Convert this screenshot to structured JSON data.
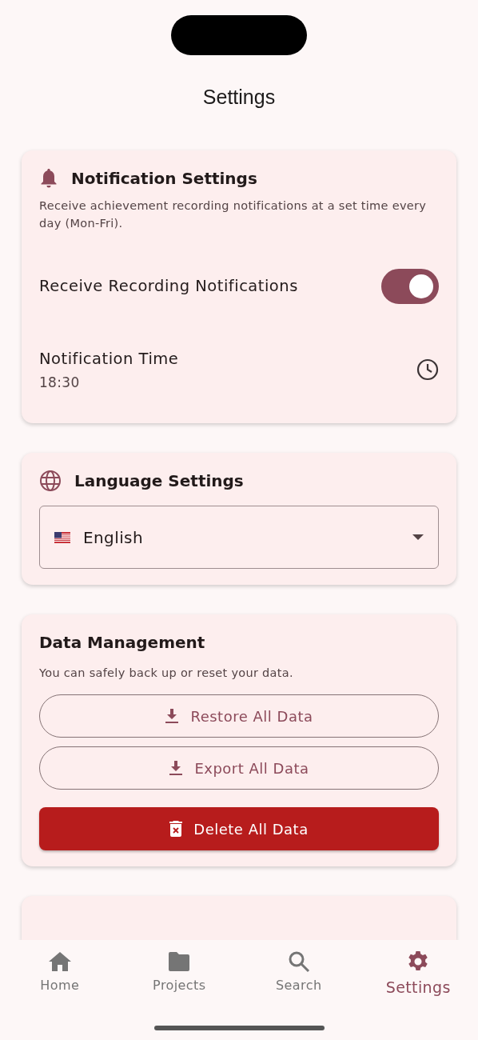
{
  "header": {
    "title": "Settings"
  },
  "notification": {
    "title": "Notification Settings",
    "description": "Receive achievement recording notifications at a set time every day (Mon-Fri).",
    "toggle": {
      "label": "Receive Recording Notifications",
      "on": true
    },
    "time": {
      "label": "Notification Time",
      "value": "18:30"
    }
  },
  "language": {
    "title": "Language Settings",
    "dropdown": {
      "value": "English"
    }
  },
  "data_management": {
    "title": "Data Management",
    "description": "You can safely back up or reset your data.",
    "buttons": [
      {
        "label": "Restore All Data",
        "kind": "outline"
      },
      {
        "label": "Export All Data",
        "kind": "outline"
      },
      {
        "label": "Delete All Data",
        "kind": "danger"
      }
    ]
  },
  "bottom_nav": [
    {
      "label": "Home",
      "selected": false
    },
    {
      "label": "Projects",
      "selected": false
    },
    {
      "label": "Search",
      "selected": false
    },
    {
      "label": "Settings",
      "selected": true
    }
  ]
}
